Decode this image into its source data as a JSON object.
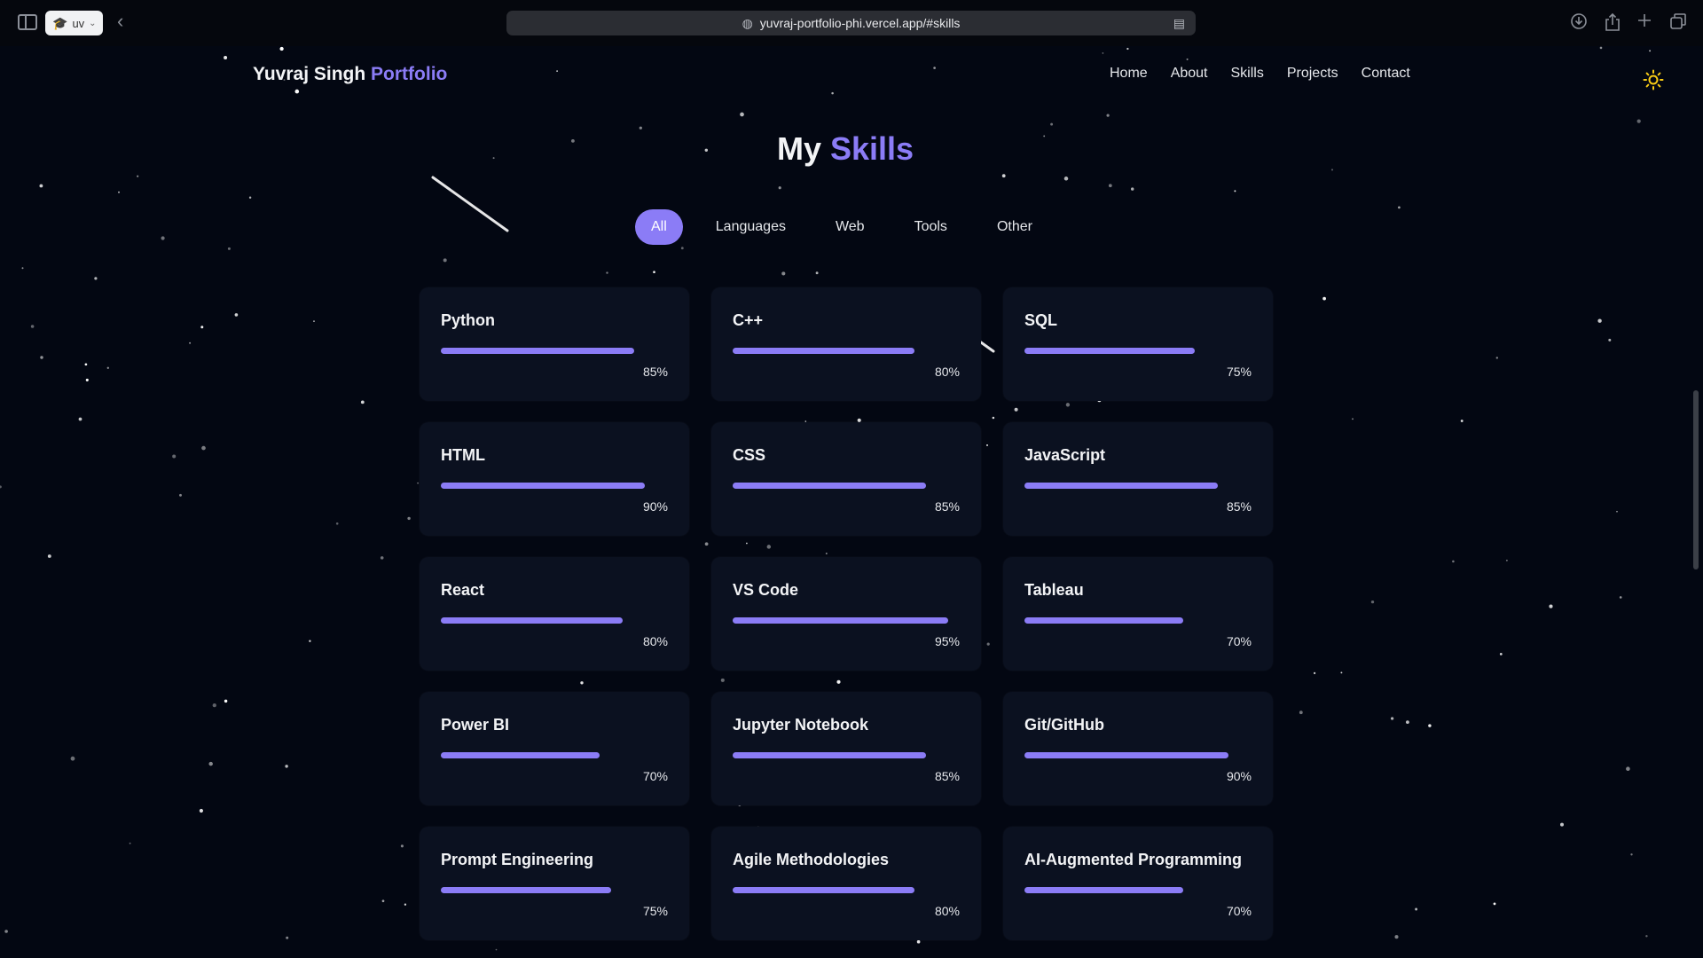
{
  "browser": {
    "profile_label": "uv",
    "url": "yuvraj-portfolio-phi.vercel.app/#skills"
  },
  "header": {
    "brand_name": "Yuvraj Singh",
    "brand_accent": "Portfolio",
    "nav": [
      "Home",
      "About",
      "Skills",
      "Projects",
      "Contact"
    ]
  },
  "section": {
    "title_plain": "My",
    "title_accent": "Skills"
  },
  "filters": {
    "items": [
      "All",
      "Languages",
      "Web",
      "Tools",
      "Other"
    ],
    "active": "All"
  },
  "skills": [
    {
      "name": "Python",
      "percent_label": "85%",
      "level": 0.85
    },
    {
      "name": "C++",
      "percent_label": "80%",
      "level": 0.8
    },
    {
      "name": "SQL",
      "percent_label": "75%",
      "level": 0.75
    },
    {
      "name": "HTML",
      "percent_label": "90%",
      "level": 0.9
    },
    {
      "name": "CSS",
      "percent_label": "85%",
      "level": 0.85
    },
    {
      "name": "JavaScript",
      "percent_label": "85%",
      "level": 0.85
    },
    {
      "name": "React",
      "percent_label": "80%",
      "level": 0.8
    },
    {
      "name": "VS Code",
      "percent_label": "95%",
      "level": 0.95
    },
    {
      "name": "Tableau",
      "percent_label": "70%",
      "level": 0.7
    },
    {
      "name": "Power BI",
      "percent_label": "70%",
      "level": 0.7
    },
    {
      "name": "Jupyter Notebook",
      "percent_label": "85%",
      "level": 0.85
    },
    {
      "name": "Git/GitHub",
      "percent_label": "90%",
      "level": 0.9
    },
    {
      "name": "Prompt Engineering",
      "percent_label": "75%",
      "level": 0.75
    },
    {
      "name": "Agile Methodologies",
      "percent_label": "80%",
      "level": 0.8
    },
    {
      "name": "AI-Augmented Programming",
      "percent_label": "70%",
      "level": 0.7
    }
  ],
  "colors": {
    "accent": "#8b7cf6",
    "background": "#030712",
    "card": "#0b1120"
  },
  "icons": {
    "theme_toggle": "sun-icon",
    "sidebar": "sidebar-toggle-icon",
    "back": "chevron-left-icon",
    "download": "download-icon",
    "share": "share-icon",
    "new_tab": "plus-icon",
    "tabs": "tab-overview-icon"
  }
}
